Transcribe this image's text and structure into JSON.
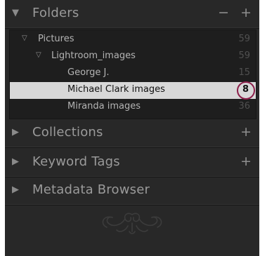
{
  "panels": {
    "folders": {
      "title": "Folders",
      "controls": "− +"
    },
    "collections": {
      "title": "Collections",
      "add": "+"
    },
    "keyword_tags": {
      "title": "Keyword Tags",
      "add": "+"
    },
    "metadata_browser": {
      "title": "Metadata Browser"
    }
  },
  "tree": [
    {
      "label": "Pictures",
      "count": "59"
    },
    {
      "label": "Lightroom_images",
      "count": "59"
    },
    {
      "label": "George J.",
      "count": "15"
    },
    {
      "label": "Michael Clark images",
      "count": "8",
      "selected": true
    },
    {
      "label": "Miranda images",
      "count": "36"
    }
  ],
  "icons": {
    "expanded": "triangle-down",
    "collapsed": "triangle-right",
    "folder_disclosure": "small-triangle-down"
  },
  "colors": {
    "panel_bg": "#282828",
    "selection_bg": "#d8d8d8",
    "highlight_ring": "#8c1f4a"
  }
}
